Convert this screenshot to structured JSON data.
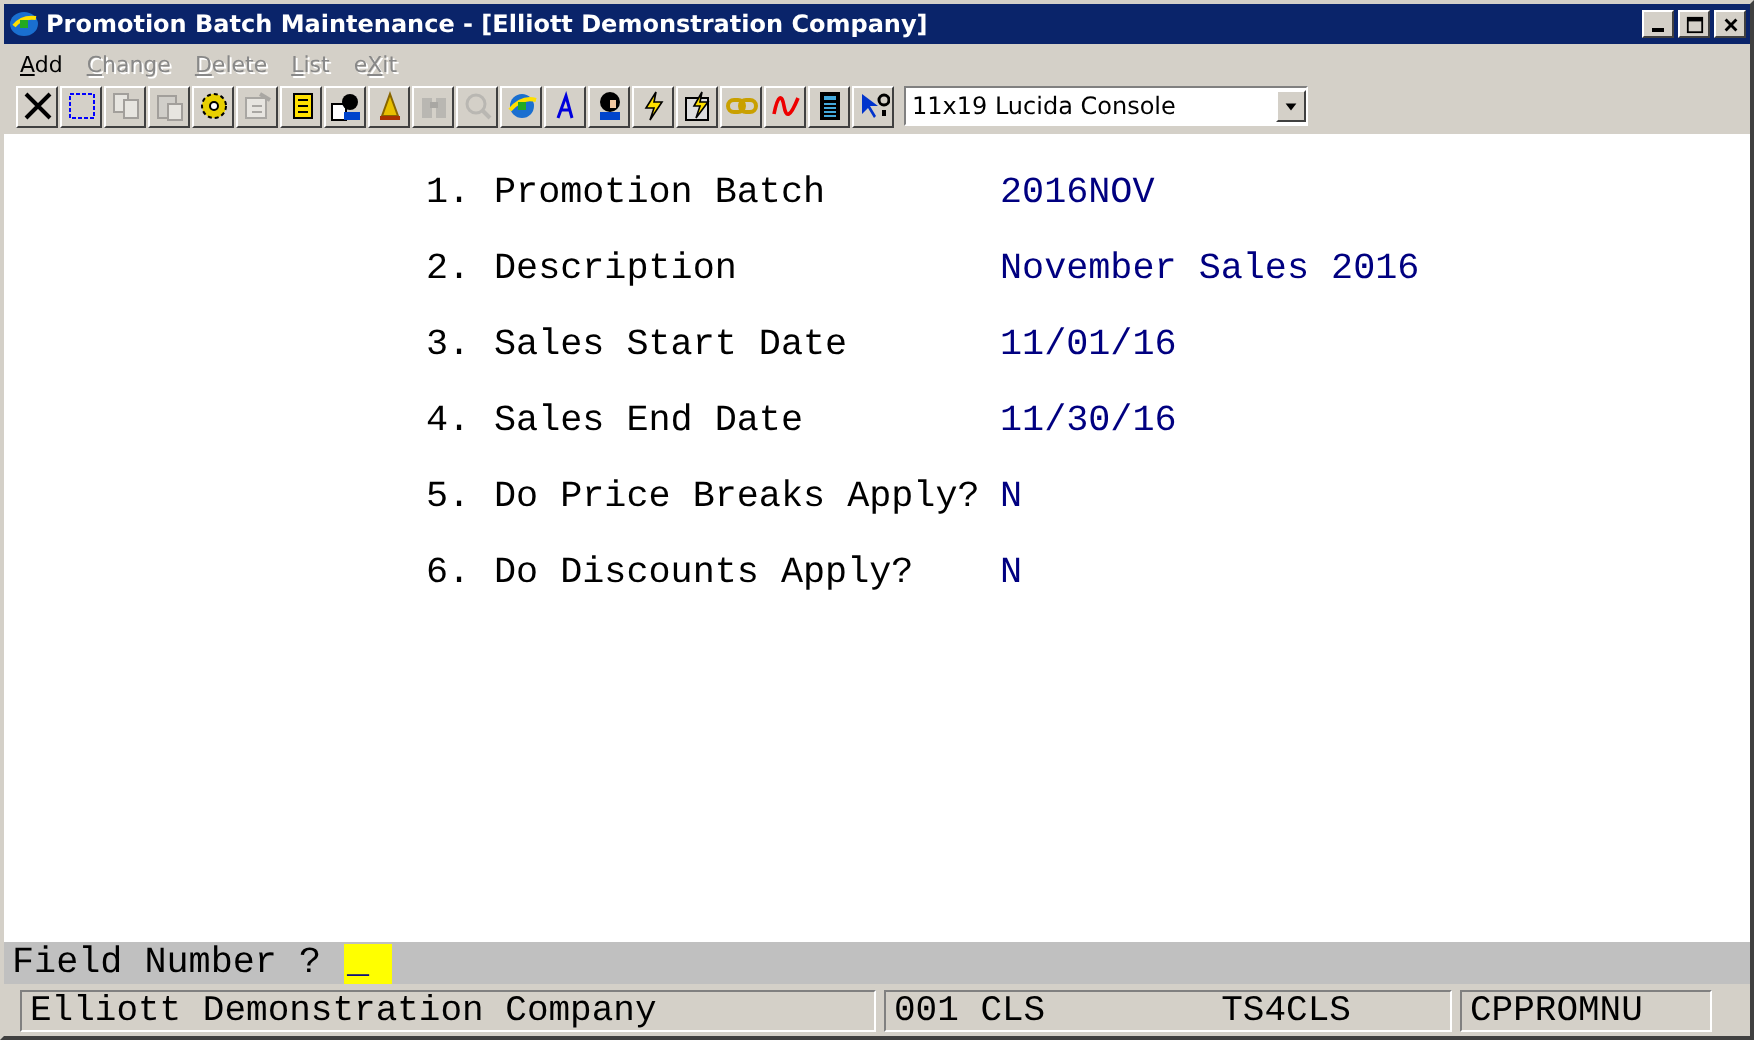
{
  "window": {
    "title": "Promotion Batch Maintenance - [Elliott Demonstration Company]"
  },
  "menu": [
    {
      "segments": [
        {
          "text": "A",
          "underlined": true
        },
        {
          "text": "dd",
          "underlined": false
        }
      ],
      "disabled": false
    },
    {
      "segments": [
        {
          "text": "C",
          "underlined": true
        },
        {
          "text": "hange",
          "underlined": false
        }
      ],
      "disabled": true
    },
    {
      "segments": [
        {
          "text": "D",
          "underlined": true
        },
        {
          "text": "elete",
          "underlined": false
        }
      ],
      "disabled": true
    },
    {
      "segments": [
        {
          "text": "L",
          "underlined": true
        },
        {
          "text": "ist",
          "underlined": false
        }
      ],
      "disabled": true
    },
    {
      "segments": [
        {
          "text": "e",
          "underlined": false
        },
        {
          "text": "X",
          "underlined": true
        },
        {
          "text": "it",
          "underlined": false
        }
      ],
      "disabled": true
    }
  ],
  "toolbar": [
    {
      "disabled": false
    },
    {
      "disabled": false
    },
    {
      "disabled": true
    },
    {
      "disabled": true
    },
    {
      "disabled": false
    },
    {
      "disabled": true
    },
    {
      "disabled": false
    },
    {
      "disabled": false
    },
    {
      "disabled": false
    },
    {
      "disabled": true
    },
    {
      "disabled": true
    },
    {
      "disabled": false
    },
    {
      "disabled": false
    },
    {
      "disabled": false
    },
    {
      "disabled": false
    },
    {
      "disabled": false
    },
    {
      "disabled": false
    },
    {
      "disabled": false
    },
    {
      "disabled": false
    },
    {
      "disabled": false
    }
  ],
  "font_select": {
    "value": "11x19 Lucida Console"
  },
  "fields": [
    {
      "number": "1.",
      "label": "Promotion Batch",
      "value": "2016NOV"
    },
    {
      "number": "2.",
      "label": "Description",
      "value": "November Sales 2016"
    },
    {
      "number": "3.",
      "label": "Sales Start Date",
      "value": "11/01/16"
    },
    {
      "number": "4.",
      "label": "Sales End Date",
      "value": "11/30/16"
    },
    {
      "number": "5.",
      "label": "Do Price Breaks Apply?",
      "value": "N"
    },
    {
      "number": "6.",
      "label": "Do Discounts Apply?",
      "value": "N"
    }
  ],
  "prompt": {
    "label": "Field Number ?",
    "value": "_"
  },
  "status_bar": {
    "company": "Elliott Demonstration Company",
    "user": "001 CLS",
    "terminal": "TS4CLS",
    "program": "CPPROMNU"
  }
}
